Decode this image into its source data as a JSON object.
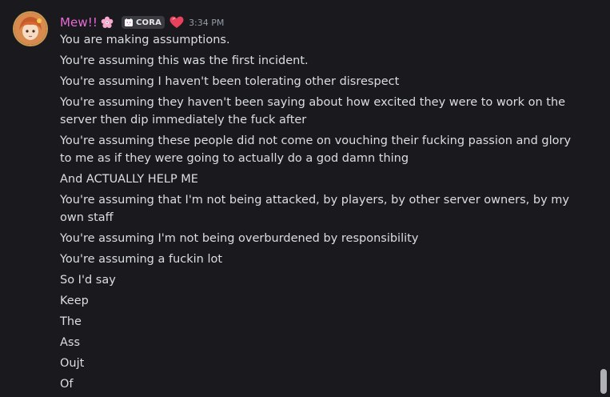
{
  "message": {
    "username": "Mew!!",
    "tag": "CORA",
    "timestamp": "3:34 PM",
    "icons": {
      "name_emoji": "cherry-blossom-icon",
      "tag_icon": "cat-icon",
      "status_emoji": "sparkling-heart-icon"
    },
    "colors": {
      "username": "#e86ad6",
      "background": "#1a1a1e",
      "text": "#dbdee1",
      "timestamp": "#949ba4"
    },
    "lines": [
      "You are making assumptions.",
      "You're assuming this was the first incident.",
      "You're assuming I haven't been tolerating other disrespect",
      "You're assuming they haven't been saying about how excited they were to work on the server then dip immediately the fuck after",
      "You're assuming these people did not come on vouching their fucking passion and glory to me as if they were going to actually do a god damn thing",
      "And ACTUALLY HELP ME",
      "You're assuming that I'm not being attacked, by players, by other server owners, by my own staff",
      "You're assuming I'm not being overburdened by responsibility",
      "You're assuming a fuckin lot",
      "So I'd say",
      "Keep",
      "The",
      "Ass",
      "Oujt",
      "Of"
    ]
  }
}
